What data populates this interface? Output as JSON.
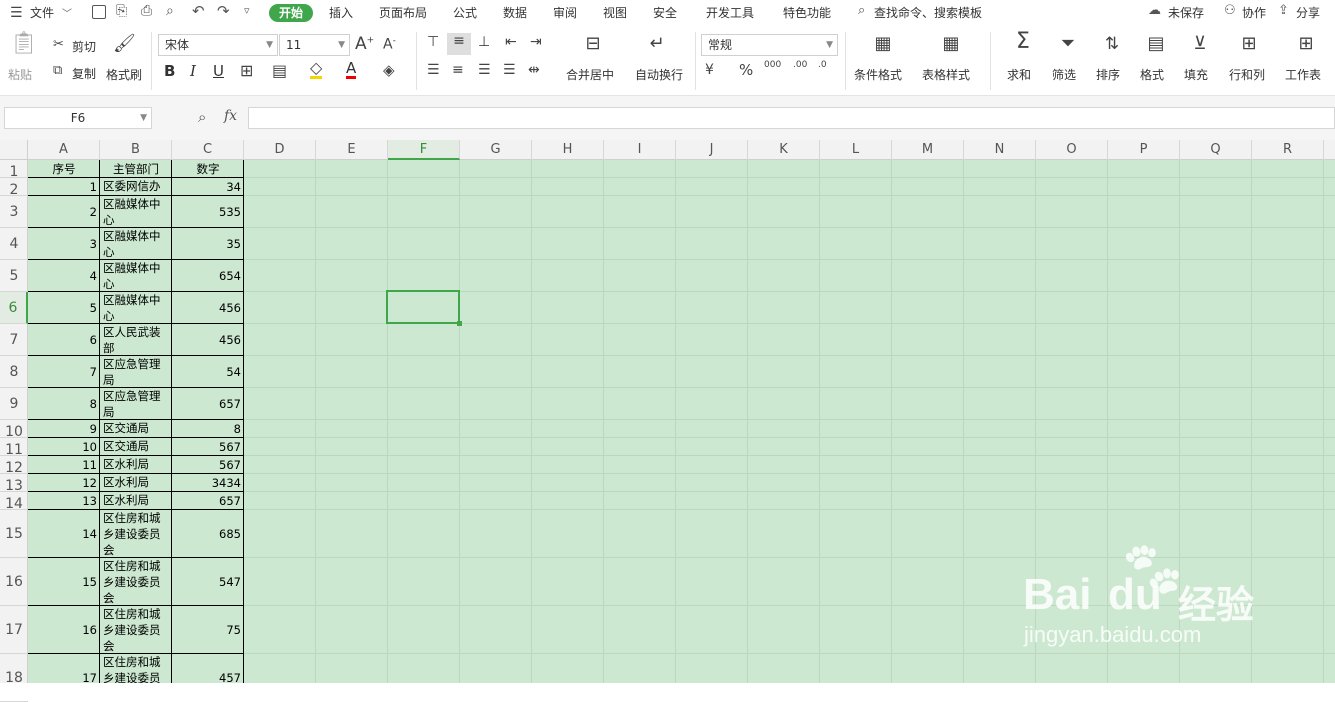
{
  "menubar": {
    "file": "文件",
    "tabs": [
      "开始",
      "插入",
      "页面布局",
      "公式",
      "数据",
      "审阅",
      "视图",
      "安全",
      "开发工具",
      "特色功能"
    ],
    "search": "查找命令、搜索模板",
    "unsaved": "未保存",
    "collab": "协作",
    "share": "分享"
  },
  "ribbon": {
    "paste": "粘贴",
    "cut": "剪切",
    "copy": "复制",
    "format_painter": "格式刷",
    "font": "宋体",
    "size": "11",
    "merge": "合并居中",
    "wrap": "自动换行",
    "num_format": "常规",
    "cond_format": "条件格式",
    "table_style": "表格样式",
    "sum": "求和",
    "filter": "筛选",
    "sort": "排序",
    "format": "格式",
    "fill": "填充",
    "rowcol": "行和列",
    "worksheet": "工作表"
  },
  "formula": {
    "cellref": "F6",
    "fx": "fx"
  },
  "columns": [
    "A",
    "B",
    "C",
    "D",
    "E",
    "F",
    "G",
    "H",
    "I",
    "J",
    "K",
    "L",
    "M",
    "N",
    "O",
    "P",
    "Q",
    "R"
  ],
  "rows": [
    "1",
    "2",
    "3",
    "4",
    "5",
    "6",
    "7",
    "8",
    "9",
    "10",
    "11",
    "12",
    "13",
    "14",
    "15",
    "16",
    "17",
    "18"
  ],
  "header": [
    "序号",
    "主管部门",
    "数字"
  ],
  "data": [
    {
      "a": "1",
      "b": [
        "区委网信办"
      ],
      "c": "34"
    },
    {
      "a": "2",
      "b": [
        "区融媒体中",
        "心"
      ],
      "c": "535"
    },
    {
      "a": "3",
      "b": [
        "区融媒体中",
        "心"
      ],
      "c": "35"
    },
    {
      "a": "4",
      "b": [
        "区融媒体中",
        "心"
      ],
      "c": "654"
    },
    {
      "a": "5",
      "b": [
        "区融媒体中",
        "心"
      ],
      "c": "456"
    },
    {
      "a": "6",
      "b": [
        "区人民武装",
        "部"
      ],
      "c": "456"
    },
    {
      "a": "7",
      "b": [
        "区应急管理",
        "局"
      ],
      "c": "54"
    },
    {
      "a": "8",
      "b": [
        "区应急管理",
        "局"
      ],
      "c": "657"
    },
    {
      "a": "9",
      "b": [
        "区交通局"
      ],
      "c": "8"
    },
    {
      "a": "10",
      "b": [
        "区交通局"
      ],
      "c": "567"
    },
    {
      "a": "11",
      "b": [
        "区水利局"
      ],
      "c": "567"
    },
    {
      "a": "12",
      "b": [
        "区水利局"
      ],
      "c": "3434"
    },
    {
      "a": "13",
      "b": [
        "区水利局"
      ],
      "c": "657"
    },
    {
      "a": "14",
      "b": [
        "区住房和城",
        "乡建设委员",
        "会"
      ],
      "c": "685"
    },
    {
      "a": "15",
      "b": [
        "区住房和城",
        "乡建设委员",
        "会"
      ],
      "c": "547"
    },
    {
      "a": "16",
      "b": [
        "区住房和城",
        "乡建设委员",
        "会"
      ],
      "c": "75"
    },
    {
      "a": "17",
      "b": [
        "区住房和城",
        "乡建设委员"
      ],
      "c": "457"
    }
  ],
  "watermark": {
    "brand": "Bai",
    "brand2": "du",
    "cn": "经验",
    "url": "jingyan.baidu.com"
  }
}
